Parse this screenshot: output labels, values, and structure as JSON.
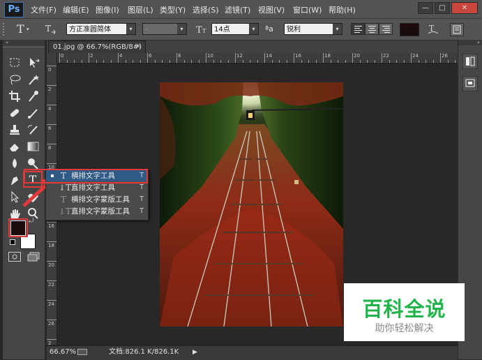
{
  "app": {
    "logo_text": "Ps"
  },
  "menu": {
    "items": [
      "文件(F)",
      "编辑(E)",
      "图像(I)",
      "图层(L)",
      "类型(Y)",
      "选择(S)",
      "滤镜(T)",
      "视图(V)",
      "窗口(W)",
      "帮助(H)"
    ]
  },
  "window_controls": {
    "minimize": "—",
    "maximize": "□",
    "close": "✕"
  },
  "options": {
    "tool_glyph": "T",
    "font_family": "方正准圆简体",
    "font_style": "-",
    "font_size": "14点",
    "aa_label": "ªa",
    "antialias": "锐利"
  },
  "document": {
    "tab_title": "01.jpg @ 66.7%(RGB/8#)",
    "tab_close": "✕"
  },
  "rulers": {
    "top": [
      "0",
      "2",
      "4",
      "6",
      "8",
      "10",
      "12",
      "14",
      "16",
      "18",
      "20",
      "22",
      "24",
      "26"
    ],
    "left": [
      "0",
      "2",
      "4",
      "6",
      "8",
      "10",
      "12",
      "14",
      "16",
      "18",
      "20",
      "22",
      "24",
      "26",
      "2"
    ]
  },
  "status": {
    "zoom": "66.67%",
    "doc_info": "文档:826.1 K/826.1K"
  },
  "type_tool_menu": {
    "items": [
      {
        "label": "横排文字工具",
        "shortcut": "T",
        "icon": "horizontal-type-icon"
      },
      {
        "label": "直排文字工具",
        "shortcut": "T",
        "icon": "vertical-type-icon"
      },
      {
        "label": "横排文字蒙版工具",
        "shortcut": "T",
        "icon": "horizontal-type-mask-icon"
      },
      {
        "label": "直排文字蒙版工具",
        "shortcut": "T",
        "icon": "vertical-type-mask-icon"
      }
    ]
  },
  "colors": {
    "foreground": "#1a0a0c",
    "background": "#ffffff",
    "highlight": "#e23a3a",
    "accent": "#22b44a"
  },
  "watermark": {
    "title": "百科全说",
    "subtitle": "助你轻松解决"
  }
}
